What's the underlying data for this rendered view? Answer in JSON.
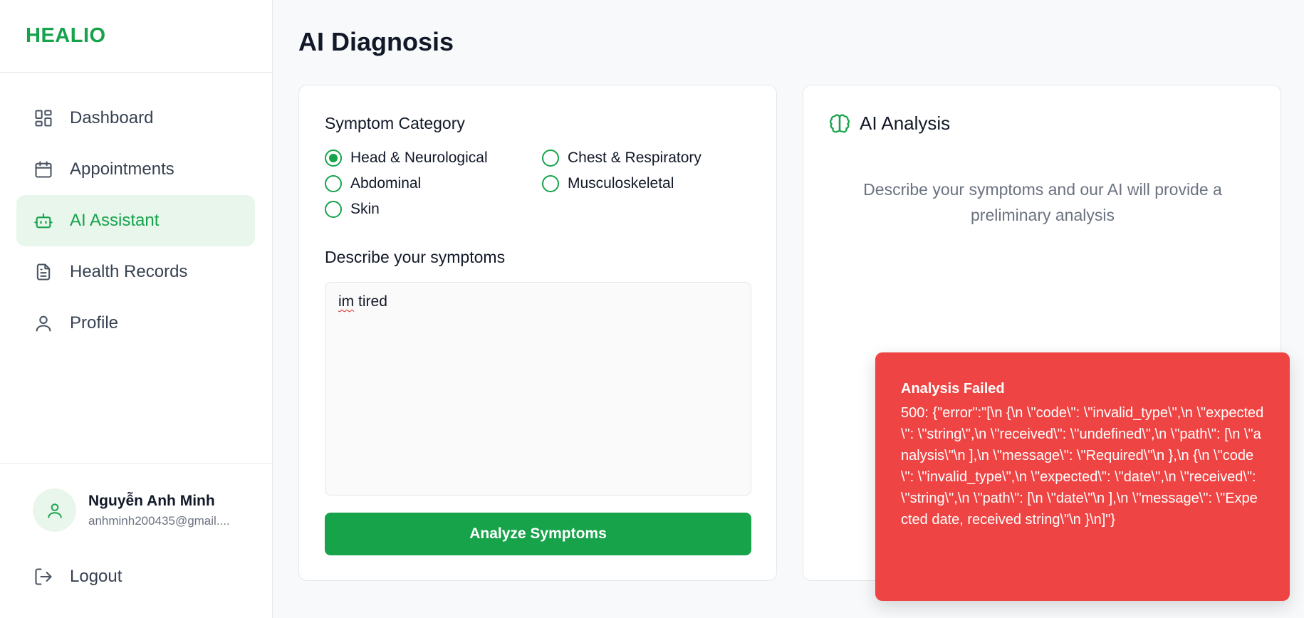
{
  "brand": "HEALIO",
  "nav": [
    {
      "label": "Dashboard",
      "icon": "dashboard-icon"
    },
    {
      "label": "Appointments",
      "icon": "calendar-icon"
    },
    {
      "label": "AI Assistant",
      "icon": "bot-icon",
      "active": true
    },
    {
      "label": "Health Records",
      "icon": "document-icon"
    },
    {
      "label": "Profile",
      "icon": "user-icon"
    }
  ],
  "user": {
    "name": "Nguyễn Anh Minh",
    "email": "anhminh200435@gmail...."
  },
  "logout_label": "Logout",
  "page_title": "AI Diagnosis",
  "symptom": {
    "category_label": "Symptom Category",
    "options": [
      "Head & Neurological",
      "Chest & Respiratory",
      "Abdominal",
      "Musculoskeletal",
      "Skin"
    ],
    "selected": "Head & Neurological",
    "describe_label": "Describe your symptoms",
    "text_word1": "im",
    "text_word2": "tired",
    "analyze_label": "Analyze Symptoms"
  },
  "analysis": {
    "title": "AI Analysis",
    "description": "Describe your symptoms and our AI will provide a preliminary analysis"
  },
  "toast": {
    "title": "Analysis Failed",
    "message": "500: {\"error\":\"[\\n {\\n \\\"code\\\": \\\"invalid_type\\\",\\n \\\"expected\\\": \\\"string\\\",\\n \\\"received\\\": \\\"undefined\\\",\\n \\\"path\\\": [\\n \\\"analysis\\\"\\n ],\\n \\\"message\\\": \\\"Required\\\"\\n },\\n {\\n \\\"code\\\": \\\"invalid_type\\\",\\n \\\"expected\\\": \\\"date\\\",\\n \\\"received\\\": \\\"string\\\",\\n \\\"path\\\": [\\n \\\"date\\\"\\n ],\\n \\\"message\\\": \\\"Expected date, received string\\\"\\n }\\n]\"}"
  },
  "colors": {
    "accent": "#16a34a",
    "accent_light": "#e8f6ec",
    "error": "#ef4444"
  }
}
